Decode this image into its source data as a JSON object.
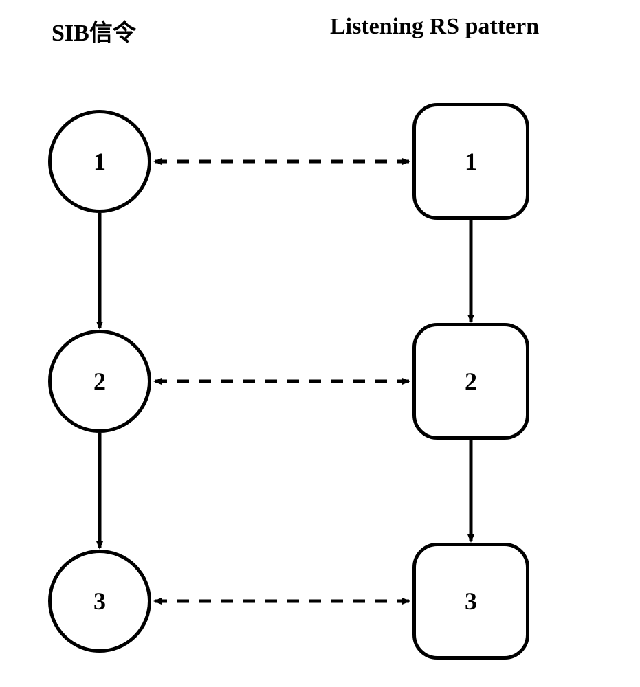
{
  "titles": {
    "left": "SIB信令",
    "right": "Listening RS pattern"
  },
  "nodes": {
    "left": [
      "1",
      "2",
      "3"
    ],
    "right": [
      "1",
      "2",
      "3"
    ]
  }
}
